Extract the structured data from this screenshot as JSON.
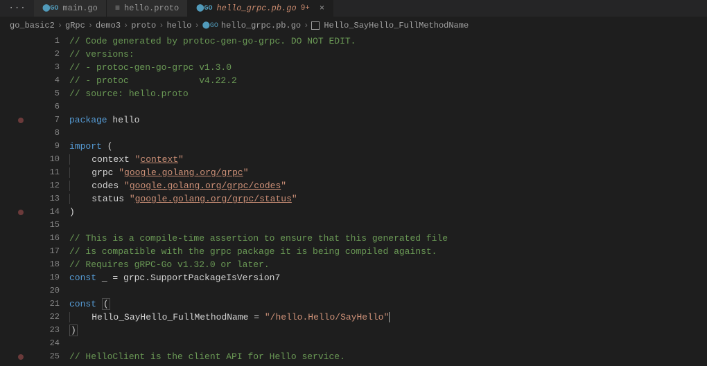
{
  "tabs": {
    "ellipsis": "···",
    "items": [
      {
        "icon": "go",
        "label": "main.go"
      },
      {
        "icon": "proto",
        "label": "hello.proto"
      },
      {
        "icon": "go",
        "label": "hello_grpc.pb.go",
        "badge": "9+",
        "modified": true,
        "active": true
      }
    ],
    "close": "×"
  },
  "breadcrumb": {
    "items": [
      "go_basic2",
      "gRpc",
      "demo3",
      "proto",
      "hello",
      "hello_grpc.pb.go",
      "Hello_SayHello_FullMethodName"
    ],
    "sep": "›"
  },
  "lines": [
    {
      "n": 1,
      "tokens": [
        {
          "t": "// Code generated by protoc-gen-go-grpc. DO NOT EDIT.",
          "c": "comment"
        }
      ]
    },
    {
      "n": 2,
      "tokens": [
        {
          "t": "// versions:",
          "c": "comment"
        }
      ]
    },
    {
      "n": 3,
      "tokens": [
        {
          "t": "// - protoc-gen-go-grpc v1.3.0",
          "c": "comment"
        }
      ]
    },
    {
      "n": 4,
      "tokens": [
        {
          "t": "// - protoc             v4.22.2",
          "c": "comment"
        }
      ]
    },
    {
      "n": 5,
      "tokens": [
        {
          "t": "// source: hello.proto",
          "c": "comment"
        }
      ]
    },
    {
      "n": 6,
      "tokens": []
    },
    {
      "n": 7,
      "bp": true,
      "tokens": [
        {
          "t": "package",
          "c": "keyword"
        },
        {
          "t": " hello",
          "c": "ident"
        }
      ]
    },
    {
      "n": 8,
      "tokens": []
    },
    {
      "n": 9,
      "tokens": [
        {
          "t": "import",
          "c": "keyword"
        },
        {
          "t": " (",
          "c": "ident"
        }
      ]
    },
    {
      "n": 10,
      "tokens": [
        {
          "t": "    ",
          "c": "ident",
          "guide": true
        },
        {
          "t": "context ",
          "c": "ident"
        },
        {
          "t": "\"",
          "c": "string"
        },
        {
          "t": "context",
          "c": "string underline"
        },
        {
          "t": "\"",
          "c": "string"
        }
      ]
    },
    {
      "n": 11,
      "tokens": [
        {
          "t": "    ",
          "c": "ident",
          "guide": true
        },
        {
          "t": "grpc ",
          "c": "ident"
        },
        {
          "t": "\"",
          "c": "string"
        },
        {
          "t": "google.golang.org/grpc",
          "c": "string underline"
        },
        {
          "t": "\"",
          "c": "string"
        }
      ]
    },
    {
      "n": 12,
      "tokens": [
        {
          "t": "    ",
          "c": "ident",
          "guide": true
        },
        {
          "t": "codes ",
          "c": "ident"
        },
        {
          "t": "\"",
          "c": "string"
        },
        {
          "t": "google.golang.org/grpc/codes",
          "c": "string underline"
        },
        {
          "t": "\"",
          "c": "string"
        }
      ]
    },
    {
      "n": 13,
      "tokens": [
        {
          "t": "    ",
          "c": "ident",
          "guide": true
        },
        {
          "t": "status ",
          "c": "ident"
        },
        {
          "t": "\"",
          "c": "string"
        },
        {
          "t": "google.golang.org/grpc/status",
          "c": "string underline"
        },
        {
          "t": "\"",
          "c": "string"
        }
      ]
    },
    {
      "n": 14,
      "bp": true,
      "tokens": [
        {
          "t": ")",
          "c": "ident"
        }
      ]
    },
    {
      "n": 15,
      "tokens": []
    },
    {
      "n": 16,
      "tokens": [
        {
          "t": "// This is a compile-time assertion to ensure that this generated file",
          "c": "comment"
        }
      ]
    },
    {
      "n": 17,
      "tokens": [
        {
          "t": "// is compatible with the grpc package it is being compiled against.",
          "c": "comment"
        }
      ]
    },
    {
      "n": 18,
      "tokens": [
        {
          "t": "// Requires gRPC-Go v1.32.0 or later.",
          "c": "comment"
        }
      ]
    },
    {
      "n": 19,
      "tokens": [
        {
          "t": "const",
          "c": "keyword"
        },
        {
          "t": " _ = grpc.SupportPackageIsVersion7",
          "c": "ident"
        }
      ]
    },
    {
      "n": 20,
      "tokens": []
    },
    {
      "n": 21,
      "tokens": [
        {
          "t": "const",
          "c": "keyword"
        },
        {
          "t": " ",
          "c": "ident"
        },
        {
          "t": "(",
          "c": "ident",
          "box": true
        }
      ]
    },
    {
      "n": 22,
      "cursor": true,
      "tokens": [
        {
          "t": "    ",
          "c": "ident",
          "guide": true
        },
        {
          "t": "Hello_SayHello_FullMethodName = ",
          "c": "ident"
        },
        {
          "t": "\"/hello.Hello/SayHello\"",
          "c": "string"
        }
      ]
    },
    {
      "n": 23,
      "tokens": [
        {
          "t": ")",
          "c": "ident",
          "box": true
        }
      ]
    },
    {
      "n": 24,
      "tokens": []
    },
    {
      "n": 25,
      "bp": true,
      "tokens": [
        {
          "t": "// HelloClient is the client API for Hello service.",
          "c": "comment"
        }
      ]
    }
  ]
}
